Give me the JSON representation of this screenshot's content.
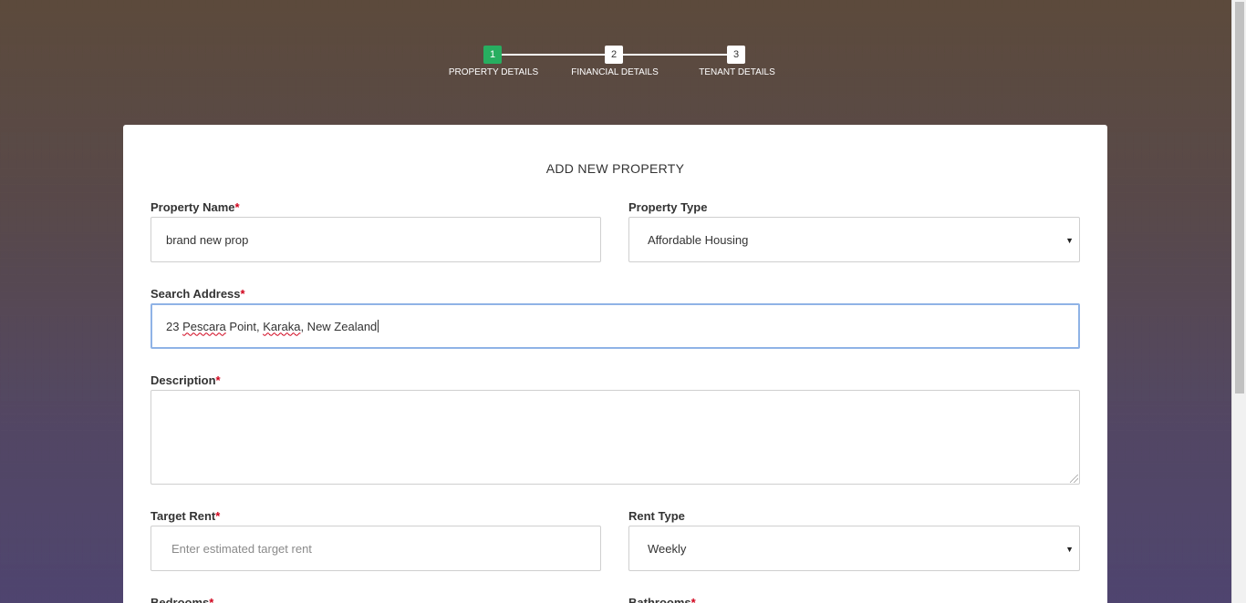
{
  "stepper": {
    "steps": [
      {
        "num": "1",
        "label": "PROPERTY DETAILS",
        "active": true
      },
      {
        "num": "2",
        "label": "FINANCIAL DETAILS",
        "active": false
      },
      {
        "num": "3",
        "label": "TENANT DETAILS",
        "active": false
      }
    ]
  },
  "form": {
    "title": "ADD NEW PROPERTY",
    "required_mark": "*",
    "property_name": {
      "label": "Property Name",
      "value": "brand new prop"
    },
    "property_type": {
      "label": "Property Type",
      "value": "Affordable Housing"
    },
    "search_address": {
      "label": "Search Address",
      "value_parts": [
        "23 ",
        "Pescara",
        " Point, ",
        "Karaka",
        ", New Zealand"
      ]
    },
    "description": {
      "label": "Description",
      "value": ""
    },
    "target_rent": {
      "label": "Target Rent",
      "placeholder": "Enter estimated target rent"
    },
    "rent_type": {
      "label": "Rent Type",
      "value": "Weekly"
    },
    "bedrooms": {
      "label": "Bedrooms"
    },
    "bathrooms": {
      "label": "Bathrooms"
    }
  },
  "icons": {
    "select_caret": "chevron-down-icon"
  },
  "colors": {
    "active_step": "#27ae60",
    "required": "#d0021b",
    "focus_border": "#8fb3e6"
  }
}
